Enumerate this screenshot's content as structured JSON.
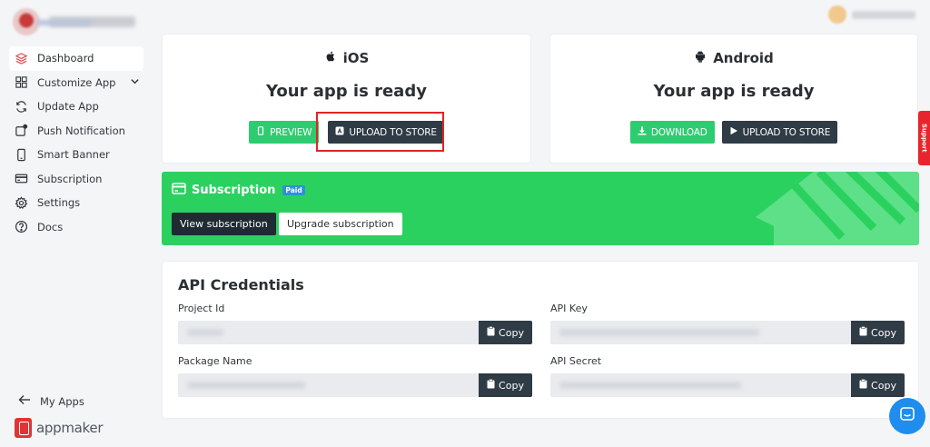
{
  "sidebar": {
    "items": [
      {
        "label": "Dashboard",
        "icon": "layers-icon"
      },
      {
        "label": "Customize App",
        "icon": "grid-icon"
      },
      {
        "label": "Update App",
        "icon": "refresh-icon"
      },
      {
        "label": "Push Notification",
        "icon": "notification-icon"
      },
      {
        "label": "Smart Banner",
        "icon": "phone-icon"
      },
      {
        "label": "Subscription",
        "icon": "card-icon"
      },
      {
        "label": "Settings",
        "icon": "gear-icon"
      },
      {
        "label": "Docs",
        "icon": "help-icon"
      }
    ],
    "my_apps": "My Apps",
    "brand": "appmaker"
  },
  "ios": {
    "title": "iOS",
    "status": "Your app is ready",
    "preview": "PREVIEW",
    "upload": "UPLOAD TO STORE"
  },
  "android": {
    "title": "Android",
    "status": "Your app is ready",
    "download": "DOWNLOAD",
    "upload": "UPLOAD TO STORE"
  },
  "subscription": {
    "title": "Subscription",
    "badge": "Paid",
    "view": "View subscription",
    "upgrade": "Upgrade subscription"
  },
  "api": {
    "title": "API Credentials",
    "project_id": "Project Id",
    "api_key": "API Key",
    "package_name": "Package Name",
    "api_secret": "API Secret",
    "copy": "Copy"
  },
  "support": "Support",
  "colors": {
    "green": "#2bd15f",
    "dark": "#2f3b45",
    "red": "#e42323",
    "accent_blue": "#1f8ded"
  }
}
